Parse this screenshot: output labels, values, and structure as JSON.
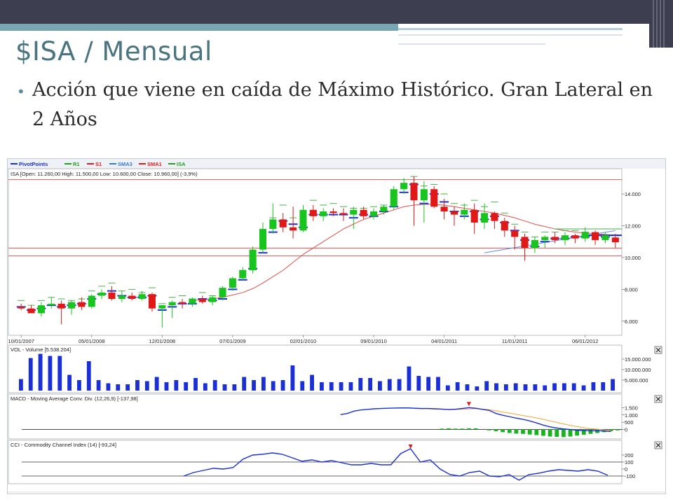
{
  "slide": {
    "title": "$ISA / Mensual",
    "bullet": "Acción que viene en caída de Máximo Histórico. Gran Lateral en 2 Años"
  },
  "chart_data": [
    {
      "type": "candlestick",
      "legend": [
        "PivotPoints",
        "R1",
        "S1",
        "SMA3",
        "SMA1",
        "ISA"
      ],
      "legend_colors": {
        "PivotPoints": "#1a2fd6",
        "R1": "#1fa01f",
        "S1": "#e01c1c",
        "SMA3": "#3a7ad8",
        "SMA1": "#e01c1c",
        "ISA": "#1fa01f"
      },
      "info": "ISA [Open: 11.260,00  High: 11.500,00  Low: 10.600,00  Close: 10.960,00] (-3,9%)",
      "x_tick_labels": [
        "10/01/2007",
        "05/01/2008",
        "12/01/2008",
        "07/01/2009",
        "02/01/2010",
        "09/01/2010",
        "04/01/2011",
        "11/01/2011",
        "06/01/2012"
      ],
      "x_tick_index": [
        0,
        7,
        14,
        21,
        28,
        35,
        42,
        49,
        56
      ],
      "y_tick_labels": [
        "6.000",
        "8.000",
        "10.000",
        "12.000",
        "14.000"
      ],
      "y_ticks": [
        6000,
        8000,
        10000,
        12000,
        14000
      ],
      "ylim": [
        5200,
        15500
      ],
      "horizontal_lines": [
        14900,
        10600,
        10100
      ],
      "candles": [
        {
          "o": 6900,
          "h": 7100,
          "l": 6700,
          "c": 6800
        },
        {
          "o": 6800,
          "h": 7000,
          "l": 6500,
          "c": 6500
        },
        {
          "o": 6500,
          "h": 7200,
          "l": 6300,
          "c": 7000
        },
        {
          "o": 7000,
          "h": 7500,
          "l": 6800,
          "c": 7100
        },
        {
          "o": 7100,
          "h": 7300,
          "l": 5800,
          "c": 6800
        },
        {
          "o": 6800,
          "h": 7300,
          "l": 6400,
          "c": 7200
        },
        {
          "o": 7200,
          "h": 7500,
          "l": 6700,
          "c": 6900
        },
        {
          "o": 6900,
          "h": 7700,
          "l": 6800,
          "c": 7600
        },
        {
          "o": 7600,
          "h": 8000,
          "l": 7400,
          "c": 7800
        },
        {
          "o": 7800,
          "h": 8200,
          "l": 7300,
          "c": 7400
        },
        {
          "o": 7400,
          "h": 7900,
          "l": 7200,
          "c": 7600
        },
        {
          "o": 7600,
          "h": 7800,
          "l": 7300,
          "c": 7400
        },
        {
          "o": 7400,
          "h": 7900,
          "l": 7300,
          "c": 7700
        },
        {
          "o": 7700,
          "h": 7800,
          "l": 6600,
          "c": 6800
        },
        {
          "o": 6800,
          "h": 7000,
          "l": 5600,
          "c": 7000
        },
        {
          "o": 7000,
          "h": 7300,
          "l": 6200,
          "c": 7200
        },
        {
          "o": 7200,
          "h": 7400,
          "l": 6800,
          "c": 7100
        },
        {
          "o": 7100,
          "h": 7500,
          "l": 6900,
          "c": 7400
        },
        {
          "o": 7400,
          "h": 7600,
          "l": 7100,
          "c": 7200
        },
        {
          "o": 7200,
          "h": 7600,
          "l": 7000,
          "c": 7500
        },
        {
          "o": 7500,
          "h": 8200,
          "l": 7300,
          "c": 8100
        },
        {
          "o": 8100,
          "h": 8800,
          "l": 7900,
          "c": 8700
        },
        {
          "o": 8700,
          "h": 9400,
          "l": 8600,
          "c": 9200
        },
        {
          "o": 9200,
          "h": 10700,
          "l": 9000,
          "c": 10500
        },
        {
          "o": 10500,
          "h": 12200,
          "l": 10300,
          "c": 11800
        },
        {
          "o": 11800,
          "h": 13400,
          "l": 11500,
          "c": 12400
        },
        {
          "o": 12400,
          "h": 12800,
          "l": 11600,
          "c": 11900
        },
        {
          "o": 11900,
          "h": 13200,
          "l": 11200,
          "c": 11700
        },
        {
          "o": 11700,
          "h": 13300,
          "l": 11600,
          "c": 13000
        },
        {
          "o": 13000,
          "h": 13300,
          "l": 12300,
          "c": 12600
        },
        {
          "o": 12600,
          "h": 13100,
          "l": 12300,
          "c": 12900
        },
        {
          "o": 12900,
          "h": 13100,
          "l": 12600,
          "c": 12800
        },
        {
          "o": 12800,
          "h": 13100,
          "l": 12300,
          "c": 12700
        },
        {
          "o": 12700,
          "h": 13200,
          "l": 11800,
          "c": 13000
        },
        {
          "o": 13000,
          "h": 13200,
          "l": 12400,
          "c": 12600
        },
        {
          "o": 12600,
          "h": 13100,
          "l": 12400,
          "c": 12900
        },
        {
          "o": 12900,
          "h": 13300,
          "l": 12700,
          "c": 13200
        },
        {
          "o": 13200,
          "h": 14500,
          "l": 13000,
          "c": 14300
        },
        {
          "o": 14300,
          "h": 15000,
          "l": 14000,
          "c": 14700
        },
        {
          "o": 14700,
          "h": 15100,
          "l": 12000,
          "c": 13600
        },
        {
          "o": 13600,
          "h": 14800,
          "l": 12200,
          "c": 14300
        },
        {
          "o": 14300,
          "h": 14500,
          "l": 13100,
          "c": 13200
        },
        {
          "o": 13200,
          "h": 13700,
          "l": 12400,
          "c": 12900
        },
        {
          "o": 12900,
          "h": 13200,
          "l": 12000,
          "c": 12700
        },
        {
          "o": 12700,
          "h": 13400,
          "l": 12400,
          "c": 13000
        },
        {
          "o": 13000,
          "h": 13400,
          "l": 11500,
          "c": 12200
        },
        {
          "o": 12200,
          "h": 13400,
          "l": 11800,
          "c": 12800
        },
        {
          "o": 12800,
          "h": 12900,
          "l": 11800,
          "c": 12300
        },
        {
          "o": 12300,
          "h": 12500,
          "l": 11300,
          "c": 11700
        },
        {
          "o": 11700,
          "h": 12000,
          "l": 10500,
          "c": 11300
        },
        {
          "o": 11300,
          "h": 11500,
          "l": 9800,
          "c": 10600
        },
        {
          "o": 10600,
          "h": 11300,
          "l": 10300,
          "c": 11100
        },
        {
          "o": 11100,
          "h": 11400,
          "l": 10600,
          "c": 11300
        },
        {
          "o": 11300,
          "h": 11600,
          "l": 10900,
          "c": 11100
        },
        {
          "o": 11100,
          "h": 11600,
          "l": 10800,
          "c": 11400
        },
        {
          "o": 11400,
          "h": 11500,
          "l": 10900,
          "c": 11200
        },
        {
          "o": 11200,
          "h": 11900,
          "l": 11000,
          "c": 11600
        },
        {
          "o": 11600,
          "h": 11700,
          "l": 10800,
          "c": 11100
        },
        {
          "o": 11100,
          "h": 11600,
          "l": 10900,
          "c": 11400
        },
        {
          "o": 11260,
          "h": 11500,
          "l": 10600,
          "c": 10960
        }
      ],
      "pivot_points": [
        6900,
        6700,
        6800,
        7000,
        6900,
        7000,
        7100,
        7400,
        7700,
        7900,
        7600,
        7500,
        7500,
        7600,
        6700,
        6900,
        7100,
        7100,
        7400,
        7300,
        7400,
        8000,
        8600,
        9300,
        10300,
        11600,
        12300,
        12100,
        11900,
        12700,
        12700,
        12700,
        12700,
        12500,
        12700,
        12600,
        12900,
        13200,
        14100,
        14600,
        13400,
        14000,
        13500,
        12900,
        12600,
        12900,
        12400,
        12600,
        12200,
        11700,
        11100,
        10700,
        11000,
        11200,
        11200,
        11300,
        11300,
        11400,
        11300,
        11400
      ],
      "r1_points": [
        7300,
        7000,
        7300,
        7500,
        7400,
        7300,
        7400,
        7900,
        8200,
        8400,
        7900,
        8000,
        7800,
        8100,
        7100,
        7500,
        7600,
        7400,
        7800,
        7600,
        7700,
        8400,
        9200,
        9900,
        11200,
        12500,
        13300,
        12500,
        12500,
        13600,
        13300,
        13400,
        13200,
        13100,
        13100,
        13200,
        13300,
        13700,
        14900,
        15100,
        14500,
        14600,
        14000,
        13400,
        13300,
        13600,
        13200,
        13500,
        12800,
        12100,
        11600,
        11300,
        11600,
        11600,
        11700,
        11700,
        11600,
        11800,
        11800,
        11800
      ],
      "sma_slow": [
        null,
        null,
        null,
        null,
        null,
        null,
        null,
        null,
        null,
        null,
        null,
        null,
        null,
        null,
        null,
        null,
        null,
        7300,
        7350,
        7400,
        7500,
        7650,
        7800,
        8050,
        8400,
        8800,
        9200,
        9700,
        10200,
        10600,
        11000,
        11400,
        11800,
        12100,
        12400,
        12600,
        12800,
        13000,
        13200,
        13300,
        13350,
        13350,
        13300,
        13200,
        13100,
        13000,
        12900,
        12800,
        12650,
        12500,
        12300,
        12100,
        11950,
        11800,
        11700,
        11600,
        11550,
        11500,
        11450,
        11400
      ],
      "sma3_line": {
        "from_index": 46,
        "to_index": 59,
        "from": 10300,
        "to": 11700
      }
    },
    {
      "type": "bar",
      "title": "VOL - Volume [5.538.204]",
      "y_tick_labels": [
        "5.000.000",
        "10.000.000",
        "15.000.000"
      ],
      "y_ticks": [
        5000000,
        10000000,
        15000000
      ],
      "ylim": [
        0,
        18000000
      ],
      "values": [
        5500000,
        15500000,
        17500000,
        16500000,
        16500000,
        7500000,
        5000000,
        14000000,
        5000000,
        3500000,
        3000000,
        3000000,
        5000000,
        4500000,
        6500000,
        4000000,
        5000000,
        4000000,
        6000000,
        3500000,
        5000000,
        3000000,
        3000000,
        6500000,
        5000000,
        6500000,
        4500000,
        5000000,
        12000000,
        4500000,
        7500000,
        4000000,
        4000000,
        4000000,
        4000000,
        6000000,
        6000000,
        4500000,
        5500000,
        5500000,
        11500000,
        7000000,
        6500000,
        6500000,
        2500000,
        4000000,
        3000000,
        2000000,
        4500000,
        3500000,
        3000000,
        3500000,
        3000000,
        3000000,
        2500000,
        3500000,
        3500000,
        3500000,
        2500000,
        4000000,
        4000000,
        5500000
      ]
    },
    {
      "type": "line",
      "title": "MACD - Moving Average Conv. Div. (12,26,9) [-137,98]",
      "y_tick_labels": [
        "0",
        "500",
        "1.000",
        "1.500"
      ],
      "y_ticks": [
        0,
        500,
        1000,
        1500
      ],
      "ylim": [
        -500,
        1900
      ],
      "macd": [
        null,
        null,
        null,
        null,
        null,
        null,
        null,
        null,
        null,
        null,
        null,
        null,
        null,
        null,
        null,
        null,
        null,
        null,
        null,
        null,
        null,
        null,
        null,
        null,
        null,
        null,
        null,
        null,
        null,
        null,
        null,
        null,
        null,
        null,
        null,
        null,
        null,
        null,
        null,
        null,
        null,
        null,
        null,
        null,
        null,
        null,
        null,
        null,
        1020,
        1100,
        1260,
        1340,
        1380,
        1420,
        1440,
        1460,
        1470,
        1480,
        1480,
        1460,
        1440,
        1440,
        1420,
        1400,
        1370,
        1390,
        1440,
        1500,
        1460,
        1380,
        1310,
        1100,
        980,
        880,
        780,
        700,
        590,
        450,
        300,
        180,
        100,
        40,
        0,
        -50,
        -70,
        -90,
        -80,
        -100,
        -138
      ],
      "signal": [
        null,
        null,
        null,
        null,
        null,
        null,
        null,
        null,
        null,
        null,
        null,
        null,
        null,
        null,
        null,
        null,
        null,
        null,
        null,
        null,
        null,
        null,
        null,
        null,
        null,
        null,
        null,
        null,
        null,
        null,
        null,
        null,
        null,
        null,
        null,
        null,
        null,
        null,
        null,
        null,
        null,
        null,
        null,
        null,
        null,
        null,
        null,
        null,
        null,
        null,
        null,
        null,
        null,
        null,
        null,
        null,
        null,
        null,
        null,
        1430,
        1420,
        1420,
        1400,
        1390,
        1380,
        1380,
        1390,
        1420,
        1420,
        1400,
        1360,
        1280,
        1200,
        1120,
        1040,
        960,
        880,
        790,
        700,
        590,
        490,
        380,
        280,
        200,
        120,
        60,
        20,
        -30,
        -80
      ],
      "histogram": [
        null,
        null,
        null,
        null,
        null,
        null,
        null,
        null,
        null,
        null,
        null,
        null,
        null,
        null,
        null,
        null,
        null,
        null,
        null,
        null,
        null,
        null,
        null,
        null,
        null,
        null,
        null,
        null,
        null,
        null,
        null,
        null,
        null,
        null,
        null,
        null,
        null,
        null,
        null,
        null,
        null,
        null,
        null,
        null,
        null,
        null,
        null,
        null,
        null,
        null,
        null,
        null,
        null,
        null,
        null,
        null,
        null,
        null,
        null,
        null,
        null,
        null,
        null,
        60,
        80,
        60,
        60,
        80,
        80,
        null,
        -60,
        -120,
        -180,
        -240,
        -280,
        -300,
        -340,
        -380,
        -430,
        -480,
        -500,
        -520,
        -480,
        -420,
        -360,
        -300,
        -240,
        -180,
        -120,
        -60
      ]
    },
    {
      "type": "line",
      "title": "CCI - Commodity Channel Index (14) [-93,24]",
      "y_tick_labels": [
        "-100",
        "0",
        "100",
        "200"
      ],
      "y_ticks": [
        -100,
        0,
        100,
        200
      ],
      "ylim": [
        -180,
        300
      ],
      "hlines": [
        100,
        -100
      ],
      "values": [
        null,
        null,
        null,
        null,
        null,
        null,
        null,
        null,
        null,
        null,
        null,
        null,
        null,
        null,
        null,
        null,
        null,
        -100,
        -50,
        -20,
        10,
        0,
        20,
        140,
        200,
        210,
        230,
        210,
        160,
        110,
        130,
        100,
        120,
        90,
        60,
        60,
        80,
        60,
        60,
        220,
        290,
        100,
        130,
        0,
        -80,
        -100,
        -50,
        -30,
        -100,
        -110,
        -80,
        -160,
        -80,
        -60,
        -30,
        -10,
        -20,
        -30,
        -10,
        -30,
        -90
      ]
    }
  ]
}
